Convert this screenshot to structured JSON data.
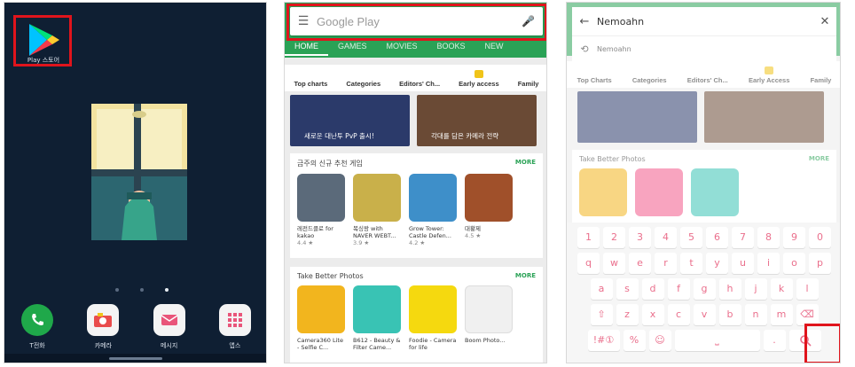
{
  "home": {
    "play_label": "Play 스토어",
    "dock": [
      {
        "label": "T전화",
        "icon": "phone-icon"
      },
      {
        "label": "카메라",
        "icon": "camera-icon"
      },
      {
        "label": "메시지",
        "icon": "message-icon"
      },
      {
        "label": "앱스",
        "icon": "apps-grid-icon"
      }
    ],
    "page_dots": 3,
    "active_dot": 2
  },
  "store": {
    "search_placeholder": "Google Play",
    "tabs": [
      "HOME",
      "GAMES",
      "MOVIES",
      "BOOKS",
      "NEW"
    ],
    "categories": [
      "Top charts",
      "Categories",
      "Editors' Ch...",
      "Early access",
      "Family"
    ],
    "banners": [
      {
        "caption": "새로운 대난투 PvP 출시!",
        "color": "#2b3a6a"
      },
      {
        "caption": "각대를 담은 카메라 전략",
        "color": "#6a4a35"
      }
    ],
    "section1": {
      "title": "금주의 신규 추천 게임",
      "more": "MORE",
      "apps": [
        {
          "name": "레전드클로 for kakao",
          "rating": "4.4 ★",
          "color": "#5b6a7a"
        },
        {
          "name": "복싱왕 with NAVER WEBT...",
          "rating": "3.9 ★",
          "color": "#c9b04a"
        },
        {
          "name": "Grow Tower: Castle Defen...",
          "rating": "4.2 ★",
          "color": "#3e8fc9"
        },
        {
          "name": "대황제",
          "rating": "4.5 ★",
          "color": "#a0502a"
        }
      ]
    },
    "section2": {
      "title": "Take Better Photos",
      "more": "MORE",
      "apps": [
        {
          "name": "Camera360 Lite - Selfie C...",
          "color": "#f2b51e"
        },
        {
          "name": "B612 - Beauty & Filter Came...",
          "color": "#39c3b4"
        },
        {
          "name": "Foodie - Camera for life",
          "color": "#f5d90f"
        },
        {
          "name": "Boom Photo...",
          "color": "#f0f0f0"
        }
      ]
    }
  },
  "search_screen": {
    "query": "Nemoahn",
    "suggestion": "Nemoahn",
    "categories": [
      "Top Charts",
      "Categories",
      "Editors' Ch...",
      "Early Access",
      "Family"
    ],
    "section_title": "Take Better Photos",
    "section_more": "MORE",
    "keyboard": {
      "row1": [
        "1",
        "2",
        "3",
        "4",
        "5",
        "6",
        "7",
        "8",
        "9",
        "0"
      ],
      "row2": [
        "q",
        "w",
        "e",
        "r",
        "t",
        "y",
        "u",
        "i",
        "o",
        "p"
      ],
      "row3": [
        "a",
        "s",
        "d",
        "f",
        "g",
        "h",
        "j",
        "k",
        "l"
      ],
      "row4": [
        "⇧",
        "z",
        "x",
        "c",
        "v",
        "b",
        "n",
        "m",
        "⌫"
      ],
      "sym_label": "!#①",
      "lang_label": "%",
      "emoji_label": "☺",
      "dot_label": "."
    }
  },
  "colors": {
    "highlight": "#e0141c",
    "store_green": "#2aa256",
    "key_text": "#ea6f8c"
  }
}
